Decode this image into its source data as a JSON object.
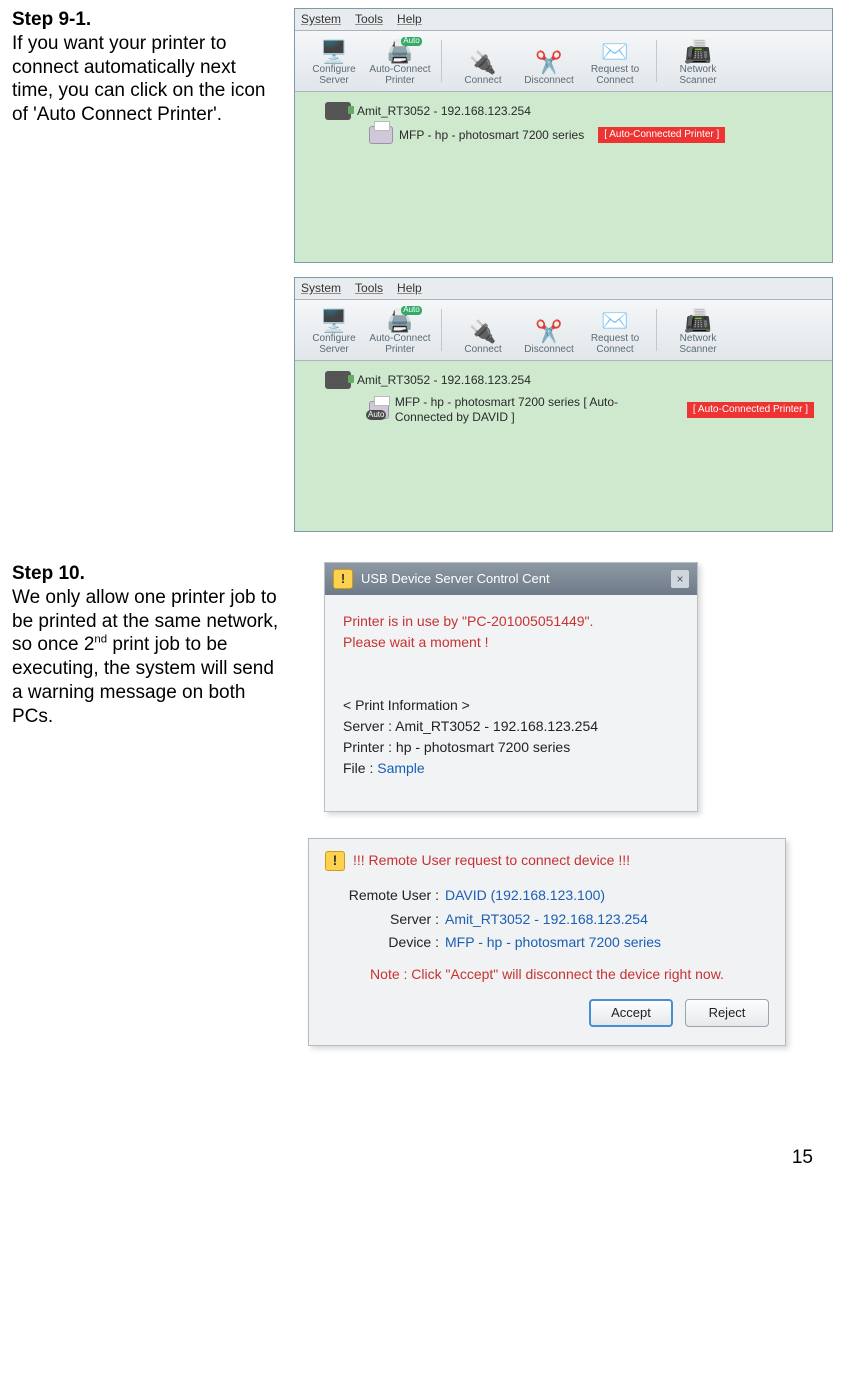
{
  "step91": {
    "title": "Step 9-1.",
    "body": "If you want your printer to connect automatically next time, you can click on the icon of 'Auto Connect Printer'."
  },
  "app1": {
    "menu": {
      "system": "System",
      "tools": "Tools",
      "help": "Help"
    },
    "toolbar": {
      "configure": "Configure\nServer",
      "autoconn": "Auto-Connect\nPrinter",
      "connect": "Connect",
      "disconnect": "Disconnect",
      "request": "Request to\nConnect",
      "scanner": "Network\nScanner"
    },
    "tree": {
      "server": "Amit_RT3052 - 192.168.123.254",
      "printer": "MFP - hp - photosmart 7200 series",
      "tag": "[ Auto-Connected Printer ]"
    }
  },
  "app2": {
    "menu": {
      "system": "System",
      "tools": "Tools",
      "help": "Help"
    },
    "toolbar": {
      "configure": "Configure\nServer",
      "autoconn": "Auto-Connect\nPrinter",
      "connect": "Connect",
      "disconnect": "Disconnect",
      "request": "Request to\nConnect",
      "scanner": "Network\nScanner"
    },
    "tree": {
      "server": "Amit_RT3052 - 192.168.123.254",
      "printer": "MFP - hp - photosmart 7200 series [ Auto-Connected by DAVID ]",
      "tag": "[ Auto-Connected Printer ]"
    }
  },
  "step10": {
    "title": "Step 10.",
    "body_pre": "We only allow one printer job to be printed at the same network, so once 2",
    "body_sup": "nd",
    "body_post": " print job to be executing, the system will send a warning message on both PCs."
  },
  "dlg1": {
    "title": "USB Device Server Control Cent",
    "l1": "Printer is in use by \"PC-201005051449\".",
    "l2": "Please wait a moment !",
    "info_hdr": "< Print Information >",
    "server_lbl": "Server : ",
    "server_val": "Amit_RT3052 - 192.168.123.254",
    "printer_lbl": "Printer : ",
    "printer_val": "hp - photosmart 7200 series",
    "file_lbl": "File : ",
    "file_val": "Sample"
  },
  "dlg2": {
    "hdr": "!!! Remote User request to connect device !!!",
    "ru_lbl": "Remote User :",
    "ru_val": "DAVID (192.168.123.100)",
    "srv_lbl": "Server :",
    "srv_val": "Amit_RT3052 - 192.168.123.254",
    "dev_lbl": "Device :",
    "dev_val": "MFP - hp - photosmart 7200 series",
    "note": "Note : Click \"Accept\" will disconnect the device right now.",
    "accept": "Accept",
    "reject": "Reject"
  },
  "page_number": "15"
}
